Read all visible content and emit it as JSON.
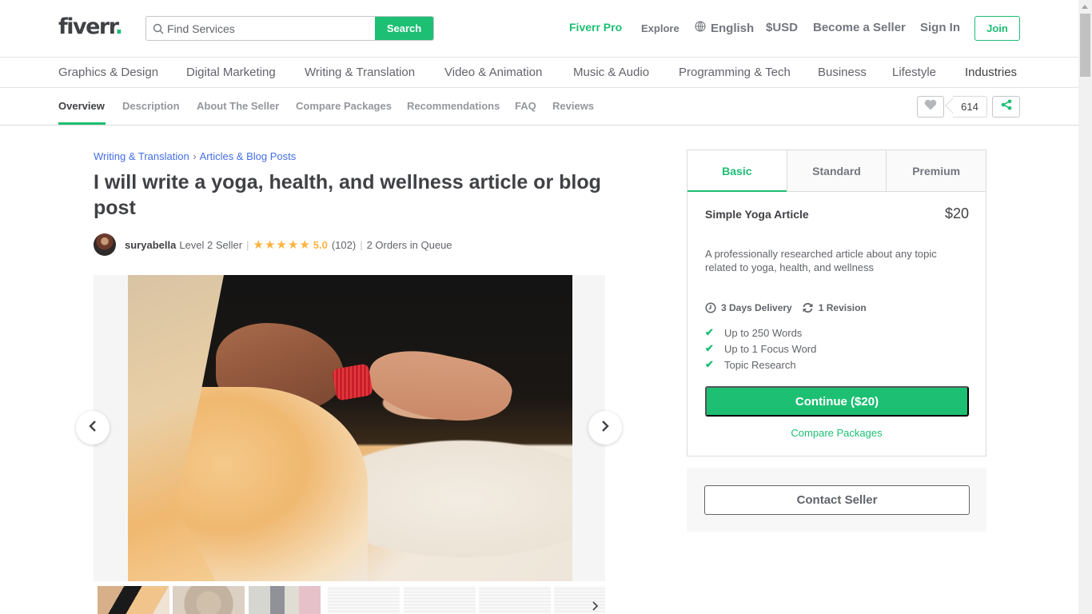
{
  "header": {
    "logo_text": "fiverr",
    "logo_dot": ".",
    "search_placeholder": "Find Services",
    "search_button": "Search",
    "nav": {
      "fiverr_pro": "Fiverr Pro",
      "explore": "Explore",
      "language": "English",
      "currency": "$USD",
      "become_seller": "Become a Seller",
      "sign_in": "Sign In",
      "join": "Join"
    }
  },
  "categories": [
    "Graphics & Design",
    "Digital Marketing",
    "Writing & Translation",
    "Video & Animation",
    "Music & Audio",
    "Programming & Tech",
    "Business",
    "Lifestyle",
    "Industries"
  ],
  "subnav": {
    "items": [
      "Overview",
      "Description",
      "About The Seller",
      "Compare Packages",
      "Recommendations",
      "FAQ",
      "Reviews"
    ],
    "active": "Overview",
    "favorites_count": "614"
  },
  "gig": {
    "breadcrumb": [
      "Writing & Translation",
      "Articles & Blog Posts"
    ],
    "breadcrumb_separator": "›",
    "title": "I will write a yoga, health, and wellness article or blog post",
    "seller": {
      "username": "suryabella",
      "level": "Level 2 Seller",
      "rating": 5.0,
      "rating_text": "5.0",
      "stars": 5,
      "reviews": "(102)",
      "queue": "2 Orders in Queue"
    },
    "gallery": {
      "image_alt": "Woman in orange saree with hand in mudra pose, red bangles",
      "thumbnail_count": 7
    }
  },
  "packages": {
    "tabs": [
      "Basic",
      "Standard",
      "Premium"
    ],
    "active_tab": "Basic",
    "basic": {
      "name": "Simple Yoga Article",
      "price": "$20",
      "description": "A professionally researched article about any topic related to yoga, health, and wellness",
      "delivery": "3 Days Delivery",
      "revisions": "1 Revision",
      "features": [
        "Up to 250 Words",
        "Up to 1 Focus Word",
        "Topic Research"
      ]
    },
    "continue_button": "Continue ($20)",
    "compare_link": "Compare Packages",
    "contact_button": "Contact Seller"
  },
  "colors": {
    "brand_green": "#1dbf73",
    "link_blue": "#446ee7",
    "star_gold": "#ffb33e",
    "text_dark": "#404145"
  }
}
